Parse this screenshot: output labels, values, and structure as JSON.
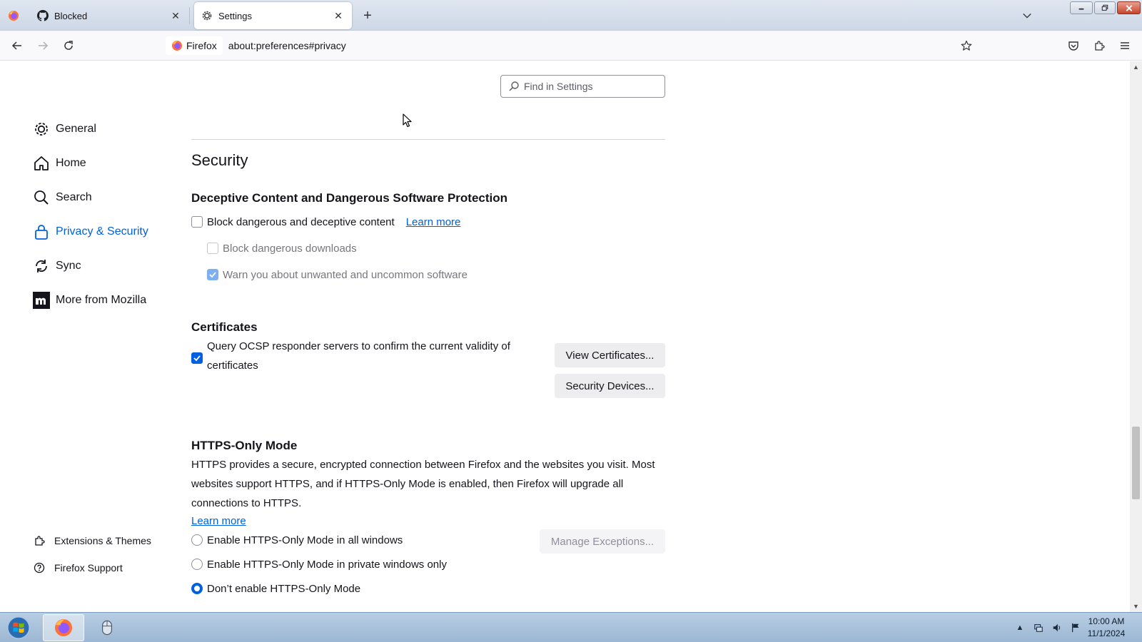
{
  "tabs": [
    {
      "title": "Blocked",
      "icon": "github-icon",
      "active": false
    },
    {
      "title": "Settings",
      "icon": "gear-icon",
      "active": true
    }
  ],
  "navbar": {
    "identity_label": "Firefox",
    "url": "about:preferences#privacy"
  },
  "search": {
    "placeholder": "Find in Settings"
  },
  "sidebar": {
    "categories": [
      {
        "label": "General",
        "icon": "gear-icon"
      },
      {
        "label": "Home",
        "icon": "home-icon"
      },
      {
        "label": "Search",
        "icon": "search-icon"
      },
      {
        "label": "Privacy & Security",
        "icon": "lock-icon",
        "selected": true
      },
      {
        "label": "Sync",
        "icon": "sync-icon"
      },
      {
        "label": "More from Mozilla",
        "icon": "mozilla-icon"
      }
    ],
    "footer": [
      {
        "label": "Extensions & Themes",
        "icon": "puzzle-icon"
      },
      {
        "label": "Firefox Support",
        "icon": "help-icon"
      }
    ]
  },
  "security": {
    "heading": "Security",
    "deceptive": {
      "heading": "Deceptive Content and Dangerous Software Protection",
      "block_label": "Block dangerous and deceptive content",
      "block_checked": false,
      "learn_more": "Learn more",
      "downloads_label": "Block dangerous downloads",
      "downloads_checked": false,
      "warn_label": "Warn you about unwanted and uncommon software",
      "warn_checked": true
    },
    "certificates": {
      "heading": "Certificates",
      "ocsp_label_line1": "Query OCSP responder servers to confirm the current validity of",
      "ocsp_label_line2": "certificates",
      "ocsp_checked": true,
      "view_button": "View Certificates...",
      "devices_button": "Security Devices..."
    },
    "https_only": {
      "heading": "HTTPS-Only Mode",
      "description": "HTTPS provides a secure, encrypted connection between Firefox and the websites you visit. Most websites support HTTPS, and if HTTPS-Only Mode is enabled, then Firefox will upgrade all connections to HTTPS.",
      "learn_more": "Learn more",
      "options": [
        {
          "label": "Enable HTTPS-Only Mode in all windows",
          "checked": false
        },
        {
          "label": "Enable HTTPS-Only Mode in private windows only",
          "checked": false
        },
        {
          "label": "Don’t enable HTTPS-Only Mode",
          "checked": true
        }
      ],
      "exceptions_button": "Manage Exceptions..."
    }
  },
  "taskbar": {
    "time": "10:00 AM",
    "date": "11/1/2024"
  },
  "colors": {
    "accent": "#0061e0",
    "text": "#15141a"
  }
}
